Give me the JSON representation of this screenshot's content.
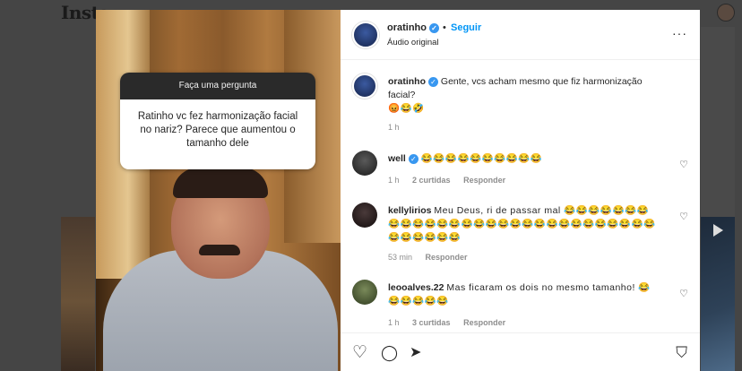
{
  "background": {
    "logo": "Insta"
  },
  "story": {
    "question_header": "Faça uma pergunta",
    "question_text": "Ratinho vc fez harmonização facial no nariz? Parece que aumentou o tamanho dele"
  },
  "post": {
    "username": "oratinho",
    "follow_label": "Seguir",
    "audio_label": "Áudio original",
    "more_label": "···"
  },
  "caption": {
    "username": "oratinho",
    "text": "Gente, vcs acham mesmo que fiz harmonização facial?",
    "emojis": "😡😂🤣",
    "time": "1 h"
  },
  "comments": [
    {
      "username": "well",
      "text": "😂😂😂😂😂😂😂😂😂😂",
      "time": "1 h",
      "likes": "2 curtidas",
      "reply": "Responder"
    },
    {
      "username": "kellylirios",
      "text": "Meu Deus, ri de passar mal 😂😂😂😂😂😂😂😂😂😂😂😂😂😂😂😂😂😂😂😂😂😂😂😂😂😂😂😂😂😂😂😂😂😂😂",
      "time": "53 min",
      "reply": "Responder"
    },
    {
      "username": "leooalves.22",
      "text": "Mas ficaram os dois no mesmo tamanho! 😂😂😂😂😂😂",
      "time": "1 h",
      "likes": "3 curtidas",
      "reply": "Responder"
    }
  ],
  "icons": {
    "heart": "heart-icon",
    "like": "♡",
    "comment": "◯",
    "share": "➤",
    "save": "⛉"
  },
  "colors": {
    "accent": "#0095f6",
    "verified": "#3897f0"
  }
}
